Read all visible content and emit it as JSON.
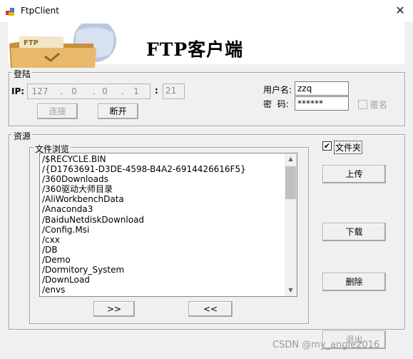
{
  "window": {
    "title": "FtpClient",
    "close_glyph": "✕"
  },
  "banner": {
    "title": "FTP客户端",
    "icon": "folder-icon"
  },
  "login": {
    "legend": "登陆",
    "ip_label": "IP:",
    "ip_octets": [
      "127",
      "0",
      "0",
      "1"
    ],
    "port_colon": ":",
    "port": "21",
    "connect_label": "连接",
    "disconnect_label": "断开",
    "username_label": "用户名:",
    "username_value": "zzq",
    "password_label": "密  码:",
    "password_value": "******",
    "anonymous_label": "匿名",
    "anonymous_checked": false
  },
  "resource": {
    "legend": "资源",
    "browse_legend": "文件浏览",
    "folder_label": "文件夹",
    "folder_checked": true,
    "check_glyph": "✔",
    "files": [
      "/$RECYCLE.BIN",
      "/{D1763691-D3DE-4598-B4A2-6914426616F5}",
      "/360Downloads",
      "/360驱动大师目录",
      "/AliWorkbenchData",
      "/Anaconda3",
      "/BaiduNetdiskDownload",
      "/Config.Msi",
      "/cxx",
      "/DB",
      "/Demo",
      "/Dormitory_System",
      "/DownLoad",
      "/envs"
    ],
    "move_right_label": ">>",
    "move_left_label": "<<",
    "upload_label": "上传",
    "download_label": "下载",
    "delete_label": "删除",
    "exit_label": "退出",
    "scroll_up_glyph": "▲",
    "scroll_down_glyph": "▼"
  },
  "watermark": "CSDN @my_angle2016",
  "colors": {
    "window_bg": "#f0f0f0",
    "banner_bg": "#ffffff",
    "folder": "#e8b96a"
  }
}
